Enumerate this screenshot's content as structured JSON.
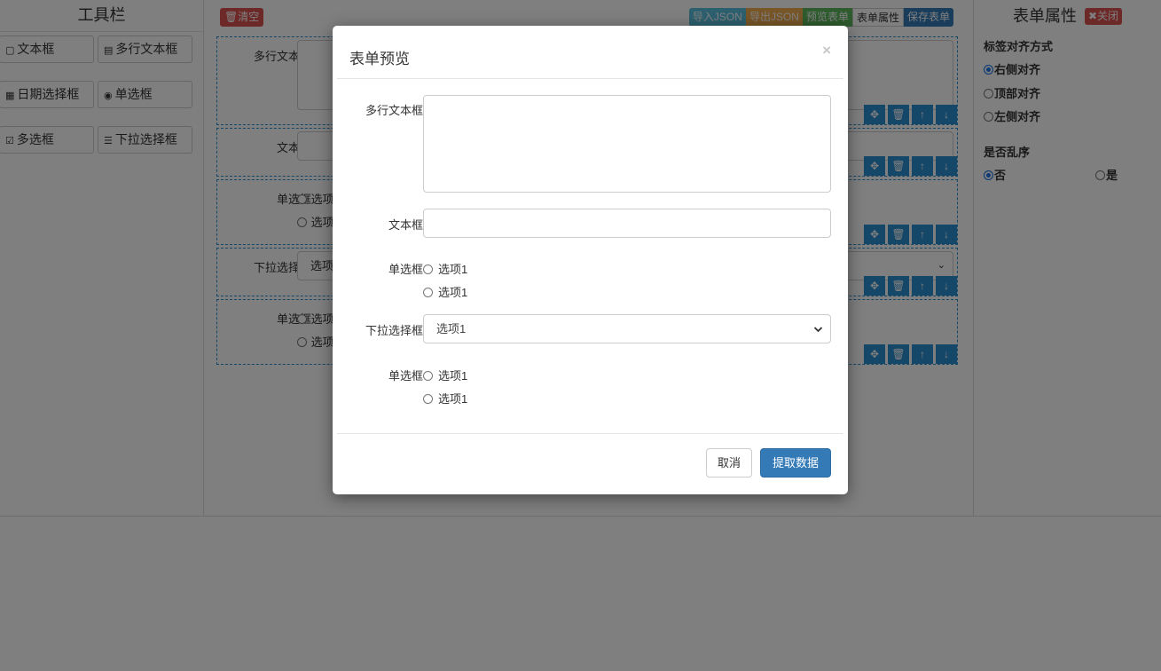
{
  "toolbar": {
    "title": "工具栏",
    "items": [
      "文本框",
      "多行文本框",
      "日期选择框",
      "单选框",
      "多选框",
      "下拉选择框"
    ]
  },
  "canvas": {
    "clear_label": "清空",
    "actions": [
      "导入JSON",
      "导出JSON",
      "预览表单",
      "表单属性",
      "保存表单"
    ],
    "fields": [
      {
        "label": "多行文本框"
      },
      {
        "label": "文本框"
      },
      {
        "label": "单选框",
        "options": [
          "选项",
          "选项"
        ]
      },
      {
        "label": "下拉选择框",
        "value": "选项"
      },
      {
        "label": "单选框",
        "options": [
          "选项",
          "选项"
        ]
      }
    ]
  },
  "props": {
    "title": "表单属性",
    "close_label": "关闭",
    "align_title": "标签对齐方式",
    "align_options": [
      "右侧对齐",
      "顶部对齐",
      "左侧对齐"
    ],
    "shuffle_title": "是否乱序",
    "shuffle_options": [
      "否",
      "是"
    ]
  },
  "modal": {
    "title": "表单预览",
    "close_symbol": "×",
    "labels": {
      "textarea": "多行文本框",
      "input": "文本框",
      "radio1": "单选框",
      "select": "下拉选择框",
      "radio2": "单选框"
    },
    "radio1_options": [
      "选项1",
      "选项1"
    ],
    "select_value": "选项1",
    "radio2_options": [
      "选项1",
      "选项1"
    ],
    "cancel_label": "取消",
    "submit_label": "提取数据"
  },
  "colors": {
    "primary": "#337ab7",
    "danger": "#d9534f",
    "info": "#5bc0de",
    "warning": "#f0ad4e",
    "success": "#5cb85c",
    "dashed_border": "#2a8fd0"
  }
}
